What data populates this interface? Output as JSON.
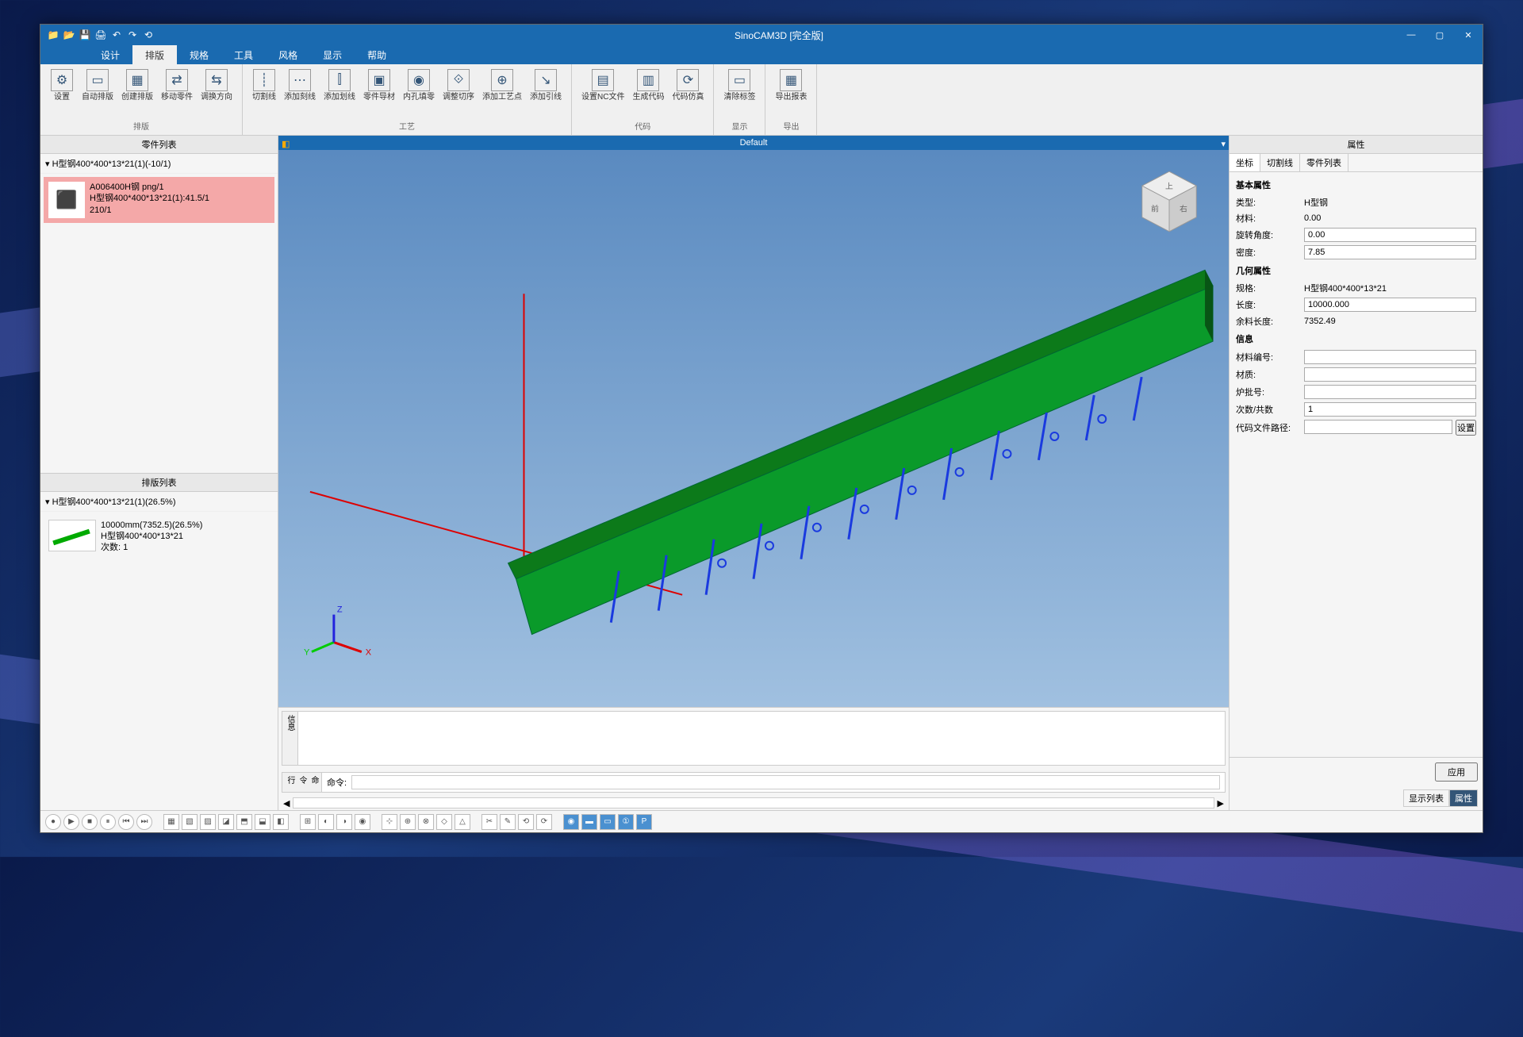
{
  "app": {
    "title": "SinoCAM3D [完全版]"
  },
  "qat": [
    "📁",
    "📂",
    "💾",
    "🖨",
    "↶",
    "↷",
    "⟲"
  ],
  "menus": [
    "设计",
    "排版",
    "规格",
    "工具",
    "风格",
    "显示",
    "帮助"
  ],
  "active_menu": 1,
  "ribbon": {
    "groups": [
      {
        "title": "排版",
        "buttons": [
          {
            "lbl": "设置",
            "ico": "⚙"
          },
          {
            "lbl": "自动排版",
            "ico": "▭"
          },
          {
            "lbl": "创建排版",
            "ico": "▦"
          },
          {
            "lbl": "移动零件",
            "ico": "⇄"
          },
          {
            "lbl": "调换方向",
            "ico": "⇆"
          }
        ]
      },
      {
        "title": "工艺",
        "buttons": [
          {
            "lbl": "切割线",
            "ico": "┊"
          },
          {
            "lbl": "添加刻线",
            "ico": "⋯"
          },
          {
            "lbl": "添加划线",
            "ico": "⫿"
          },
          {
            "lbl": "零件导材",
            "ico": "▣"
          },
          {
            "lbl": "内孔填零",
            "ico": "◉"
          },
          {
            "lbl": "调整切序",
            "ico": "⟐"
          },
          {
            "lbl": "添加工艺点",
            "ico": "⊕"
          },
          {
            "lbl": "添加引线",
            "ico": "↘"
          }
        ]
      },
      {
        "title": "代码",
        "buttons": [
          {
            "lbl": "设置NC文件",
            "ico": "▤"
          },
          {
            "lbl": "生成代码",
            "ico": "▥"
          },
          {
            "lbl": "代码仿真",
            "ico": "⟳"
          }
        ]
      },
      {
        "title": "显示",
        "buttons": [
          {
            "lbl": "清除标签",
            "ico": "▭"
          }
        ]
      },
      {
        "title": "导出",
        "buttons": [
          {
            "lbl": "导出报表",
            "ico": "▦"
          }
        ]
      }
    ]
  },
  "viewport": {
    "title": "Default"
  },
  "parts_panel": {
    "title": "零件列表",
    "tree": "H型钢400*400*13*21(1)(-10/1)",
    "card": {
      "line1": "A006400H钢 png/1",
      "line2": "H型钢400*400*13*21(1):41.5/1",
      "line3": "210/1"
    }
  },
  "sheets_panel": {
    "title": "排版列表",
    "tree": "H型钢400*400*13*21(1)(26.5%)",
    "card": {
      "line1": "10000mm(7352.5)(26.5%)",
      "line2": "H型钢400*400*13*21",
      "line3": "次数: 1"
    }
  },
  "properties": {
    "title": "属性",
    "tabs": [
      "坐标",
      "切割线",
      "零件列表"
    ],
    "sections": {
      "basic": "基本属性",
      "geom": "几何属性",
      "info": "信息"
    },
    "rows": {
      "type_k": "类型:",
      "type_v": "H型钢",
      "thick_k": "材料:",
      "thick_v": "0.00",
      "rot_k": "旋转角度:",
      "rot_v": "0.00",
      "dens_k": "密度:",
      "dens_v": "7.85",
      "spec_k": "规格:",
      "spec_v": "H型钢400*400*13*21",
      "len_k": "长度:",
      "len_v": "10000.000",
      "rem_k": "余料长度:",
      "rem_v": "7352.49",
      "matno_k": "材料编号:",
      "matno_v": "",
      "mat_k": "材质:",
      "mat_v": "",
      "heat_k": "炉批号:",
      "heat_v": "",
      "cnt_k": "次数/共数",
      "cnt_v": "1",
      "cfile_k": "代码文件路径:",
      "cfile_v": ""
    },
    "apply": "应用",
    "browse": "设置"
  },
  "bottom": {
    "tab1": "信息",
    "tab2": "命令行",
    "cmd_label": "命令:"
  },
  "status_tabs": [
    "显示列表",
    "属性"
  ]
}
